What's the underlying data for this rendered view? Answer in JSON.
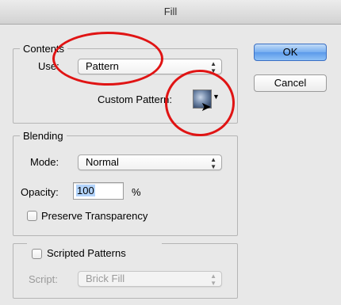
{
  "window": {
    "title": "Fill"
  },
  "contents": {
    "legend": "Contents",
    "use_label": "Use:",
    "use_value": "Pattern",
    "custom_pattern_label": "Custom Pattern:"
  },
  "buttons": {
    "ok": "OK",
    "cancel": "Cancel"
  },
  "blending": {
    "legend": "Blending",
    "mode_label": "Mode:",
    "mode_value": "Normal",
    "opacity_label": "Opacity:",
    "opacity_value": "100",
    "opacity_unit": "%",
    "preserve_transparency_label": "Preserve Transparency",
    "preserve_transparency_checked": false
  },
  "scripted": {
    "legend_label": "Scripted Patterns",
    "enabled": false,
    "script_label": "Script:",
    "script_value": "Brick Fill"
  },
  "annotations": {
    "highlight_color": "#e01414"
  }
}
